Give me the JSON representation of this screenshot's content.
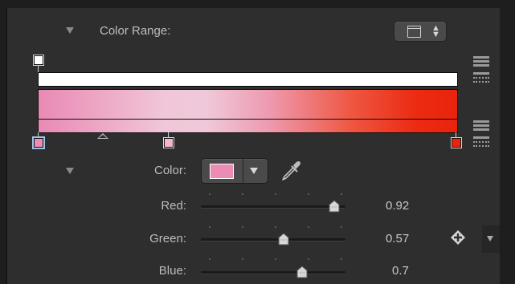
{
  "section": {
    "title": "Color Range:"
  },
  "gradient": {
    "stop_colors": [
      "#ea8cb4",
      "#f0b8cc",
      "#e9230c"
    ],
    "stop_positions": [
      0,
      0.31,
      1
    ],
    "opacity_stop_color": "#ffffff",
    "midpoint_position": 0.16
  },
  "color": {
    "label": "Color:",
    "swatch": "#ea8cb4",
    "dropdown_icon": "chevron-down-icon",
    "eyedropper_icon": "eyedropper-icon"
  },
  "channels": [
    {
      "key": "red",
      "label": "Red:",
      "value": "0.92",
      "fraction": 0.92
    },
    {
      "key": "green",
      "label": "Green:",
      "value": "0.57",
      "fraction": 0.57
    },
    {
      "key": "blue",
      "label": "Blue:",
      "value": "0.7",
      "fraction": 0.7
    }
  ],
  "icons": {
    "preset": "preset-menu-icon",
    "keyframe": "add-keyframe-icon",
    "stack": "stack-distribute-icon"
  }
}
